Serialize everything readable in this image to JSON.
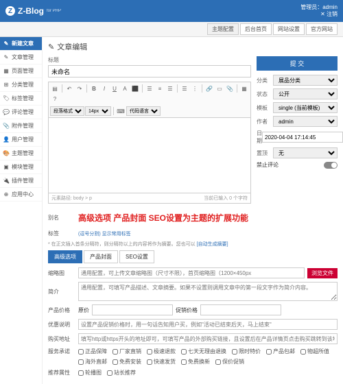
{
  "header": {
    "logo": "Z-Blog",
    "sub": "for PHP",
    "admin_label": "管理员：",
    "admin_name": "admin",
    "logout": "注销"
  },
  "topnav": {
    "items": [
      "主题配置",
      "后台首页",
      "网站设置",
      "官方网站"
    ]
  },
  "sidebar": {
    "items": [
      {
        "icon": "✎",
        "label": "新建文章"
      },
      {
        "icon": "✎",
        "label": "文章管理"
      },
      {
        "icon": "▦",
        "label": "页面管理"
      },
      {
        "icon": "⊞",
        "label": "分类管理"
      },
      {
        "icon": "🏷",
        "label": "标签管理"
      },
      {
        "icon": "💬",
        "label": "评论管理"
      },
      {
        "icon": "📎",
        "label": "附件管理"
      },
      {
        "icon": "👤",
        "label": "用户管理"
      },
      {
        "icon": "🎨",
        "label": "主题管理"
      },
      {
        "icon": "▣",
        "label": "模块管理"
      },
      {
        "icon": "🔌",
        "label": "插件管理"
      },
      {
        "icon": "⊕",
        "label": "应用中心"
      }
    ]
  },
  "page": {
    "title": "文章编辑",
    "title_label": "标题",
    "title_value": "未命名"
  },
  "editor": {
    "fontsize": "14px",
    "status_left": "元素路径: body > p",
    "status_right": "当前已输入 0 个字符"
  },
  "meta": {
    "submit": "提 交",
    "category_label": "分类",
    "category_value": "展品分类",
    "status_label": "状态",
    "status_value": "公开",
    "template_label": "模板",
    "template_value": "single (当前模板)",
    "author_label": "作者",
    "author_value": "admin",
    "date_label": "日期",
    "date_value": "2020-04-04 17:14:45",
    "pin_label": "置顶",
    "pin_value": "无",
    "comment_label": "禁止评论",
    "comment_off": "OFF"
  },
  "lower": {
    "alias_label": "别名",
    "tags_label": "标签",
    "banner": "高级选项  产品封面  SEO设置为主题的扩展功能",
    "banner_note": "(逗号分割) 显示常用标签",
    "hint_prefix": "* 在正文插入首条分隔符，则分隔符以上的内容将作为摘要。您也可以",
    "hint_link": "[自动生成摘要]",
    "tabs": [
      "高级选项",
      "产品封面",
      "SEO设置"
    ],
    "thumb_label": "缩略图",
    "thumb_placeholder": "通用配置，可上传文章缩略图（尺寸不限），首页缩略图（1200×450px",
    "browse": "浏览文件",
    "intro_label": "简介",
    "intro_placeholder": "通用配置，可填写产品描述、文章摘要。如果不设置则调用文章中的第一段文字作为简介内容。",
    "price_label": "产品价格",
    "price1_label": "原价",
    "price2_label": "促销价格",
    "promo_label": "优惠说明",
    "promo_placeholder": "设置产品促销价格时，用一句话告知用户买，例如\"活动已结束后天，马上结束\"",
    "buy_label": "购买地址",
    "buy_placeholder": "填写http或https开头的地址即可，可填写产品的外部购买链接，且设置后在产品详情页点击购买跳转到该地址",
    "service_label": "服务承诺",
    "services": [
      "正品保障",
      "厂家直销",
      "极速退款",
      "七天无理由退换",
      "限时特价",
      "产品包邮",
      "物超所值",
      "海外直邮",
      "免费安装",
      "快速发货",
      "免费换新",
      "保价促销"
    ],
    "rec_label": "推荐属性",
    "rec_items": [
      "轮播图",
      "站长推荐"
    ]
  }
}
